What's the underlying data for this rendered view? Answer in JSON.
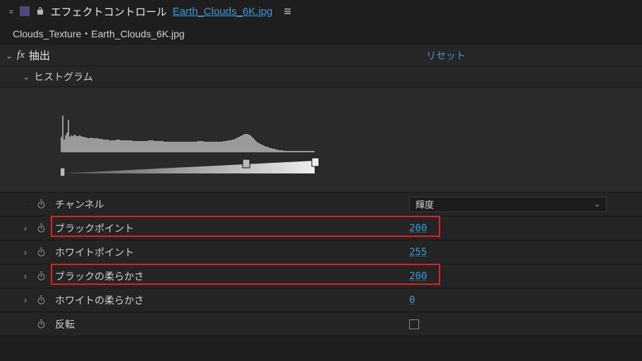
{
  "header": {
    "panel_title": "エフェクトコントロール",
    "file_name": "Earth_Clouds_6K.jpg",
    "menu_glyph": "≡"
  },
  "breadcrumb": "Clouds_Texture・Earth_Clouds_6K.jpg",
  "effect": {
    "name": "抽出",
    "reset_label": "リセット",
    "fx_glyph": "fx"
  },
  "histogram": {
    "label": "ヒストグラム"
  },
  "params": {
    "channel": {
      "label": "チャンネル",
      "value": "輝度"
    },
    "black_point": {
      "label": "ブラックポイント",
      "value": "200"
    },
    "white_point": {
      "label": "ホワイトポイント",
      "value": "255"
    },
    "black_softness": {
      "label": "ブラックの柔らかさ",
      "value": "200"
    },
    "white_softness": {
      "label": "ホワイトの柔らかさ",
      "value": "0"
    },
    "invert": {
      "label": "反転"
    }
  },
  "highlights": [
    "black_point",
    "black_softness"
  ]
}
